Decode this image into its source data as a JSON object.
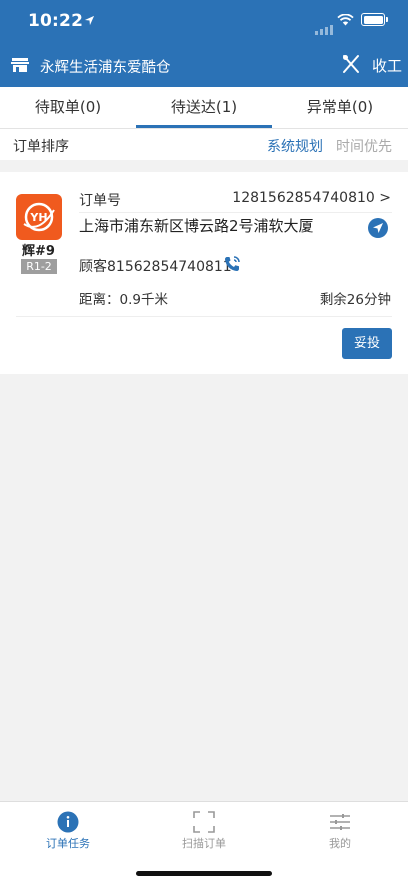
{
  "status_bar": {
    "time": "10:22"
  },
  "header": {
    "store_name": "永辉生活浦东爱酷仓",
    "finish_label": "收工"
  },
  "tabs": [
    {
      "label": "待取单(0)",
      "active": false
    },
    {
      "label": "待送达(1)",
      "active": true
    },
    {
      "label": "异常单(0)",
      "active": false
    }
  ],
  "sort": {
    "label": "订单排序",
    "options": [
      "系统规划",
      "时间优先"
    ],
    "selected": "系统规划"
  },
  "order": {
    "logo_text": "YH",
    "sequence": "辉#9",
    "zone": "R1-2",
    "order_label": "订单号",
    "order_number": "1281562854740810 >",
    "address": "上海市浦东新区博云路2号浦软大厦",
    "customer": "顾客81562854740811",
    "distance": "距离：0.9千米",
    "remaining": "剩余26分钟",
    "action_label": "妥投"
  },
  "tabbar": [
    {
      "label": "订单任务",
      "icon": "info-icon",
      "active": true
    },
    {
      "label": "扫描订单",
      "icon": "scan-icon",
      "active": false
    },
    {
      "label": "我的",
      "icon": "sliders-icon",
      "active": false
    }
  ],
  "colors": {
    "primary": "#2b72b6",
    "logo": "#f05a1e",
    "background": "#f2f2f2"
  }
}
